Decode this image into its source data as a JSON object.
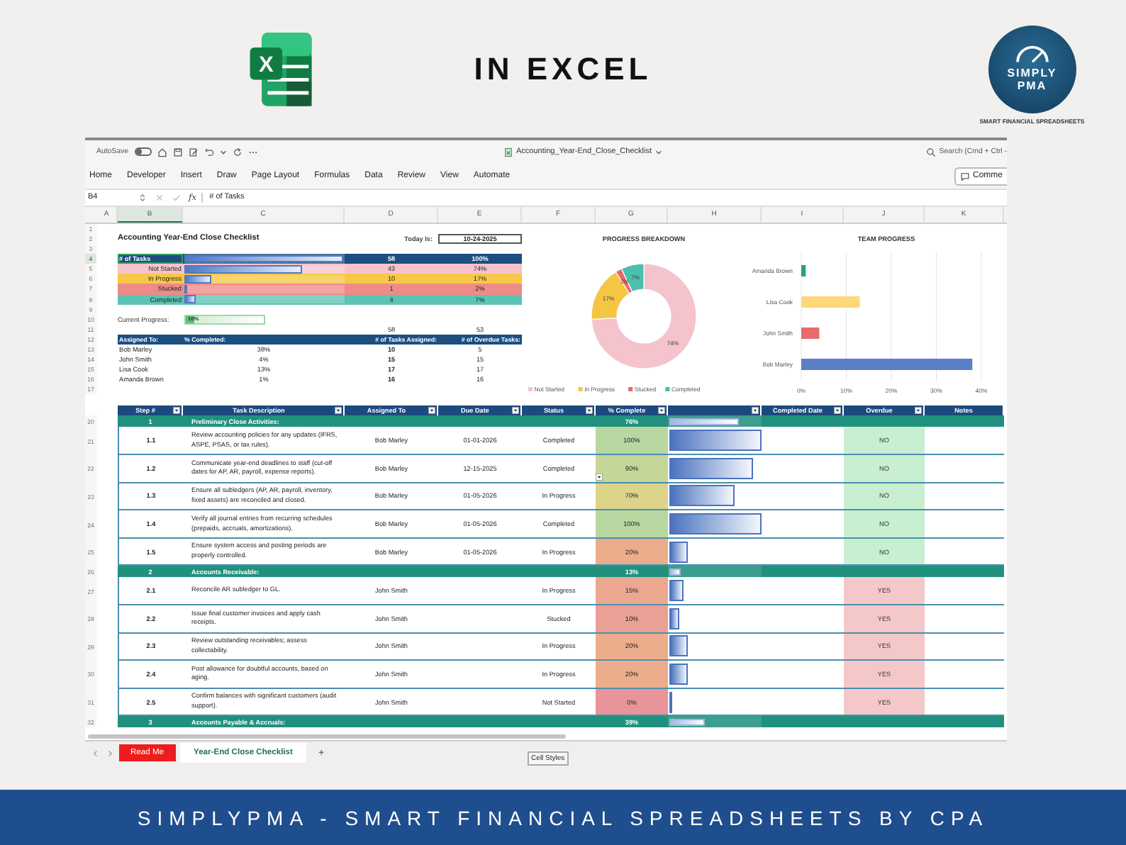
{
  "header": {
    "title": "IN EXCEL",
    "app_icon": {
      "letter": "X"
    },
    "brand": {
      "name": "SIMPLY",
      "sub": "PMA",
      "tagline": "SMART FINANCIAL SPREADSHEETS"
    }
  },
  "titlebar": {
    "autosave_label": "AutoSave",
    "autosave_on": false,
    "file_name": "Accounting_Year-End_Close_Checklist",
    "search_placeholder": "Search (Cmd + Ctrl -"
  },
  "ribbon": {
    "tabs": [
      {
        "label": "Home",
        "selected": false
      },
      {
        "label": "Developer",
        "selected": false
      },
      {
        "label": "Insert",
        "selected": false
      },
      {
        "label": "Draw",
        "selected": false
      },
      {
        "label": "Page Layout",
        "selected": false
      },
      {
        "label": "Formulas",
        "selected": false
      },
      {
        "label": "Data",
        "selected": false
      },
      {
        "label": "Review",
        "selected": false
      },
      {
        "label": "View",
        "selected": false
      },
      {
        "label": "Automate",
        "selected": false
      }
    ],
    "comments_label": "Comme"
  },
  "formula_bar": {
    "cell_ref": "B4",
    "fx_label": "fx",
    "formula": "# of Tasks"
  },
  "columns": [
    {
      "letter": "A",
      "selected": false
    },
    {
      "letter": "B",
      "selected": true
    },
    {
      "letter": "C",
      "selected": false
    },
    {
      "letter": "D",
      "selected": false
    },
    {
      "letter": "E",
      "selected": false
    },
    {
      "letter": "F",
      "selected": false
    },
    {
      "letter": "G",
      "selected": false
    },
    {
      "letter": "H",
      "selected": false
    },
    {
      "letter": "I",
      "selected": false
    },
    {
      "letter": "J",
      "selected": false
    },
    {
      "letter": "K",
      "selected": false
    }
  ],
  "sheet": {
    "row_numbers": [
      {
        "label": "1",
        "selected": false
      },
      {
        "label": "2",
        "selected": false
      },
      {
        "label": "3",
        "selected": false
      },
      {
        "label": "4",
        "selected": true
      },
      {
        "label": "5",
        "selected": false
      },
      {
        "label": "6",
        "selected": false
      },
      {
        "label": "7",
        "selected": false
      },
      {
        "label": "8",
        "selected": false
      },
      {
        "label": "9",
        "selected": false
      },
      {
        "label": "10",
        "selected": false
      },
      {
        "label": "11",
        "selected": false
      },
      {
        "label": "12",
        "selected": false
      },
      {
        "label": "13",
        "selected": false
      },
      {
        "label": "14",
        "selected": false
      },
      {
        "label": "15",
        "selected": false
      },
      {
        "label": "16",
        "selected": false
      },
      {
        "label": "17",
        "selected": false
      }
    ],
    "title": "Accounting Year-End Close Checklist",
    "today_label": "Today Is:",
    "today_value": "10-24-2025",
    "summary": [
      {
        "kind": "total",
        "label": "# of Tasks",
        "count": "58",
        "percent": "100%",
        "level": 1,
        "color": "#1c4e80",
        "selected": true
      },
      {
        "kind": "status",
        "label": "Not Started",
        "count": "43",
        "percent": "74%",
        "level": 0.74,
        "color": "#f5c3cc",
        "selected": false
      },
      {
        "kind": "status",
        "label": "In Progress",
        "count": "10",
        "percent": "17%",
        "level": 0.17,
        "color": "#f7c847",
        "selected": false
      },
      {
        "kind": "status",
        "label": "Stucked",
        "count": "1",
        "percent": "2%",
        "level": 0.02,
        "color": "#ef8b87",
        "selected": false
      },
      {
        "kind": "status",
        "label": "Completed",
        "count": "4",
        "percent": "7%",
        "level": 0.07,
        "color": "#5cc4b3",
        "selected": false
      }
    ],
    "progress": {
      "label": "Current Progress:",
      "value": "10%",
      "level": 0.1
    },
    "totals": [
      "58",
      "53"
    ],
    "assignee_columns": [
      "Assigned To:",
      "% Completed:",
      "# of Tasks Assigned:",
      "# of Overdue Tasks:"
    ],
    "assignees": [
      {
        "name": "Bob Marley",
        "completed": "38%",
        "tasks": "10",
        "overdue": "5"
      },
      {
        "name": "John Smith",
        "completed": "4%",
        "tasks": "15",
        "overdue": "15"
      },
      {
        "name": "Lisa Cook",
        "completed": "13%",
        "tasks": "17",
        "overdue": "17"
      },
      {
        "name": "Amanda Brown",
        "completed": "1%",
        "tasks": "16",
        "overdue": "16"
      }
    ]
  },
  "progress_chart": {
    "chart_data": {
      "type": "donut",
      "title": "PROGRESS BREAKDOWN",
      "categories": [
        "Not Started",
        "In Progress",
        "Stucked",
        "Completed"
      ],
      "values": [
        74,
        17,
        2,
        7
      ],
      "colors": [
        "#f5c3cc",
        "#f5c544",
        "#e8696b",
        "#4dbfae"
      ],
      "value_labels": [
        "74%",
        "17%",
        "2%",
        "7%"
      ],
      "legend": "bottom"
    }
  },
  "team_chart": {
    "chart_data": {
      "type": "bar",
      "orientation": "horizontal",
      "title": "TEAM PROGRESS",
      "categories": [
        "Amanda Brown",
        "Lisa Cook",
        "John Smith",
        "Bob Marley"
      ],
      "values": [
        1,
        13,
        4,
        38
      ],
      "colors": [
        "#2e9e8a",
        "#fdd77a",
        "#e86a6a",
        "#5b7fc7"
      ],
      "xlim": [
        0,
        40
      ],
      "grid": true,
      "xticks": [
        {
          "value": 0,
          "label": "0%"
        },
        {
          "value": 10,
          "label": "10%"
        },
        {
          "value": 20,
          "label": "20%"
        },
        {
          "value": 30,
          "label": "30%"
        },
        {
          "value": 40,
          "label": "40%"
        }
      ]
    }
  },
  "table": {
    "columns": [
      {
        "label": "Step #",
        "filter": true
      },
      {
        "label": "Task Description",
        "filter": true
      },
      {
        "label": "Assigned To",
        "filter": true
      },
      {
        "label": "Due Date",
        "filter": true
      },
      {
        "label": "Status",
        "filter": true
      },
      {
        "label": "% Complete",
        "filter": true
      },
      {
        "filter": true
      },
      {
        "label": "Completed Date",
        "filter": true
      },
      {
        "label": "Overdue",
        "filter": true
      },
      {
        "label": "Notes",
        "filter": false
      }
    ],
    "rows": [
      {
        "kind": "section",
        "row": "20",
        "step": "1",
        "title": "Preliminary Close Activities:",
        "percent": "76%",
        "level": 0.76
      },
      {
        "kind": "task",
        "row": "21",
        "step": "1.1",
        "description": "Review accounting policies for any updates (IFRS, ASPE, PSAS, or tax rules).",
        "assigned": "Bob Marley",
        "due": "01-01-2026",
        "status": "Completed",
        "percent": "100%",
        "level": 1,
        "dropdown": false,
        "overdue": false,
        "overdue_label": "NO"
      },
      {
        "kind": "task",
        "row": "22",
        "step": "1.2",
        "description": "Communicate year-end deadlines to staff (cut-off dates for AP, AR, payroll, expense reports).",
        "assigned": "Bob Marley",
        "due": "12-15-2025",
        "status": "Completed",
        "percent": "90%",
        "level": 0.9,
        "dropdown": true,
        "overdue": false,
        "overdue_label": "NO"
      },
      {
        "kind": "task",
        "row": "23",
        "step": "1.3",
        "description": "Ensure all subledgers (AP, AR, payroll, inventory, fixed assets) are reconciled and closed.",
        "assigned": "Bob Marley",
        "due": "01-05-2026",
        "status": "In Progress",
        "percent": "70%",
        "level": 0.7,
        "dropdown": false,
        "overdue": false,
        "overdue_label": "NO"
      },
      {
        "kind": "task",
        "row": "24",
        "step": "1.4",
        "description": "Verify all journal entries from recurring schedules (prepaids, accruals, amortizations).",
        "assigned": "Bob Marley",
        "due": "01-05-2026",
        "status": "Completed",
        "percent": "100%",
        "level": 1,
        "dropdown": false,
        "overdue": false,
        "overdue_label": "NO"
      },
      {
        "kind": "task",
        "row": "25",
        "step": "1.5",
        "description": "Ensure system access and posting periods are properly controlled.",
        "assigned": "Bob Marley",
        "due": "01-05-2026",
        "status": "In Progress",
        "percent": "20%",
        "level": 0.2,
        "dropdown": false,
        "overdue": false,
        "overdue_label": "NO"
      },
      {
        "kind": "section",
        "row": "26",
        "step": "2",
        "title": "Accounts Receivable:",
        "percent": "13%",
        "level": 0.13
      },
      {
        "kind": "task",
        "row": "27",
        "step": "2.1",
        "description": "Reconcile AR subledger to GL.",
        "assigned": "John Smith",
        "status": "In Progress",
        "percent": "15%",
        "level": 0.15,
        "dropdown": false,
        "overdue": true,
        "overdue_label": "YES"
      },
      {
        "kind": "task",
        "row": "28",
        "step": "2.2",
        "description": "Issue final customer invoices and apply cash receipts.",
        "assigned": "John Smith",
        "status": "Stucked",
        "percent": "10%",
        "level": 0.1,
        "dropdown": false,
        "overdue": true,
        "overdue_label": "YES"
      },
      {
        "kind": "task",
        "row": "29",
        "step": "2.3",
        "description": "Review outstanding receivables; assess collectability.",
        "assigned": "John Smith",
        "status": "In Progress",
        "percent": "20%",
        "level": 0.2,
        "dropdown": false,
        "overdue": true,
        "overdue_label": "YES"
      },
      {
        "kind": "task",
        "row": "30",
        "step": "2.4",
        "description": "Post allowance for doubtful accounts, based on aging.",
        "assigned": "John Smith",
        "status": "In Progress",
        "percent": "20%",
        "level": 0.2,
        "dropdown": false,
        "overdue": true,
        "overdue_label": "YES"
      },
      {
        "kind": "task",
        "row": "31",
        "step": "2.5",
        "description": "Confirm balances with significant customers (audit support).",
        "assigned": "John Smith",
        "status": "Not Started",
        "percent": "0%",
        "level": 0,
        "dropdown": false,
        "overdue": true,
        "overdue_label": "YES"
      },
      {
        "kind": "section",
        "row": "32",
        "step": "3",
        "title": "Accounts Payable & Accruals:",
        "percent": "39%",
        "level": 0.39
      }
    ]
  },
  "sheet_tabs": [
    {
      "label": "Read Me",
      "selected": false,
      "color": "#ee1c1c"
    },
    {
      "label": "Year-End Close Checklist",
      "selected": true
    }
  ],
  "add_sheet_label": "+",
  "status_tooltip": "Cell Styles",
  "footer": "SIMPLYPMA - SMART FINANCIAL SPREADSHEETS BY CPA"
}
